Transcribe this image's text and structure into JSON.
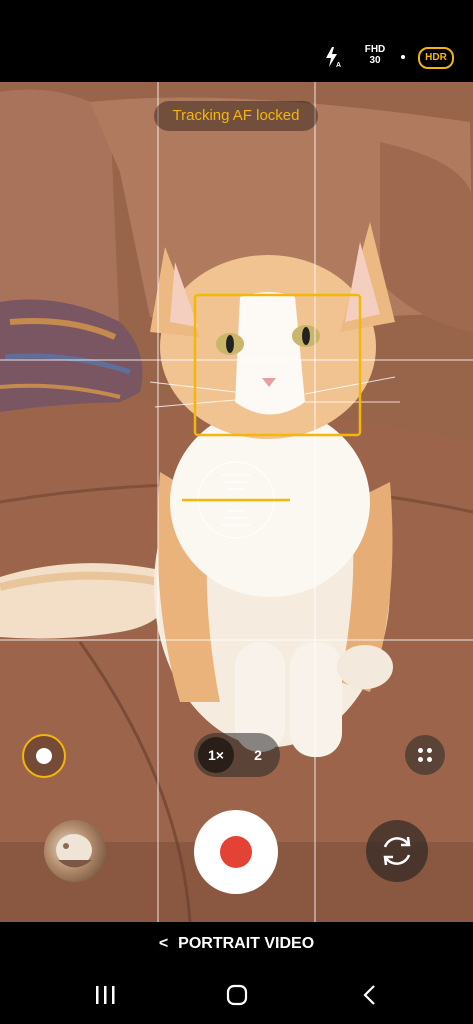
{
  "status_bar": {
    "flash_icon": "flash-auto-icon",
    "video_quality_line1": "FHD",
    "video_quality_line2": "30",
    "hdr_label": "HDR",
    "hdr_color": "#f3b70b"
  },
  "viewfinder": {
    "af_status": "Tracking AF locked",
    "af_color": "#f3b70b",
    "subject": "cat-on-sofa"
  },
  "controls": {
    "mode_icon": "record-mode-icon",
    "zoom_options": [
      "1×",
      "2"
    ],
    "zoom_selected": "1×",
    "more_icon": "four-dots-icon",
    "shutter_icon": "record-icon",
    "shutter_color": "#e34234",
    "flip_icon": "switch-camera-icon",
    "gallery_icon": "gallery-thumbnail"
  },
  "mode_bar": {
    "back_glyph": "<",
    "label": "PORTRAIT VIDEO"
  },
  "nav_bar": {
    "recent_icon": "recent-apps-icon",
    "home_icon": "home-icon",
    "back_icon": "back-icon"
  }
}
